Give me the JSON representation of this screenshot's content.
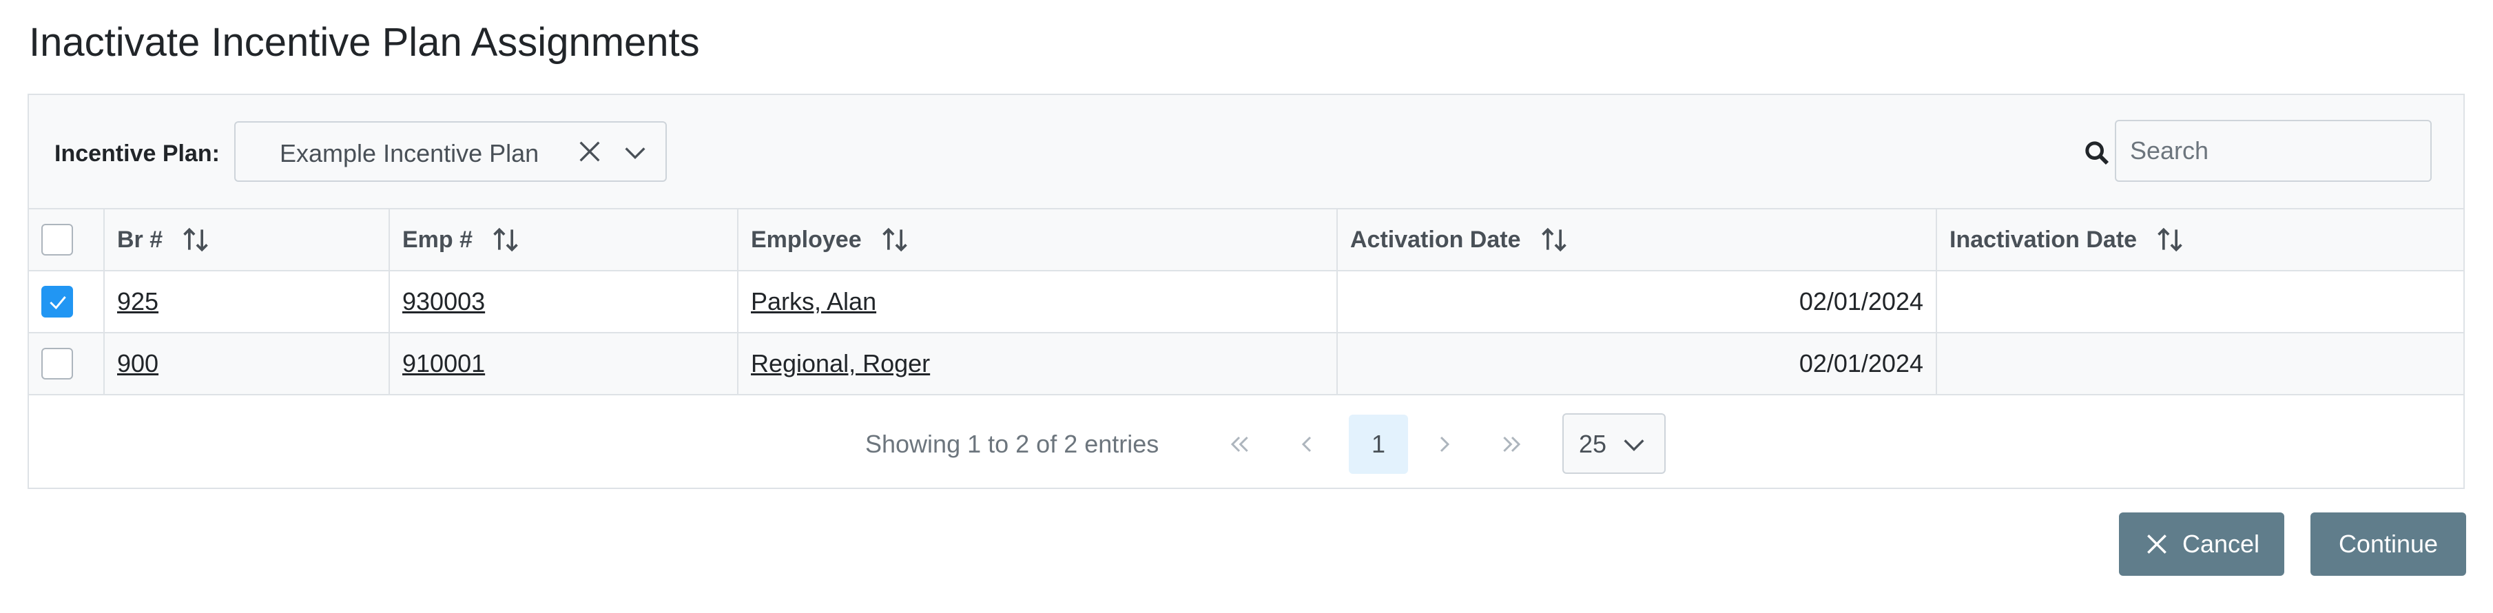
{
  "page": {
    "title": "Inactivate Incentive Plan Assignments"
  },
  "filter": {
    "incentive_plan_label": "Incentive Plan:",
    "incentive_plan_value": "Example Incentive Plan",
    "search_placeholder": "Search"
  },
  "table": {
    "columns": [
      "Br #",
      "Emp #",
      "Employee",
      "Activation Date",
      "Inactivation Date"
    ],
    "rows": [
      {
        "selected": true,
        "branch": "925",
        "emp_no": "930003",
        "employee": "Parks, Alan",
        "activation_date": "02/01/2024",
        "inactivation_date": ""
      },
      {
        "selected": false,
        "branch": "900",
        "emp_no": "910001",
        "employee": "Regional, Roger",
        "activation_date": "02/01/2024",
        "inactivation_date": ""
      }
    ]
  },
  "pagination": {
    "info": "Showing 1 to 2 of 2 entries",
    "current_page": "1",
    "rows_per_page": "25"
  },
  "actions": {
    "cancel_label": "Cancel",
    "continue_label": "Continue"
  },
  "colors": {
    "accent_checkbox": "#2196f3",
    "button_bg": "#607d8b",
    "current_page_bg": "#e3f2fd"
  },
  "icons": {
    "clear": "close-icon",
    "dropdown": "chevron-down-icon",
    "search": "search-icon",
    "sort": "sort-icon",
    "first": "double-chevron-left-icon",
    "prev": "chevron-left-icon",
    "next": "chevron-right-icon",
    "last": "double-chevron-right-icon",
    "check": "check-icon"
  }
}
